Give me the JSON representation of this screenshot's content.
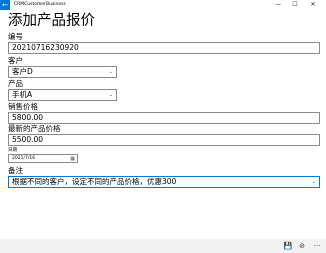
{
  "window": {
    "app_title": "CRMCustomerBusiness",
    "back_glyph": "←",
    "minimize_glyph": "—",
    "maximize_glyph": "☐",
    "close_glyph": "✕"
  },
  "page": {
    "title": "添加产品报价"
  },
  "form": {
    "number_label": "编号",
    "number_value": "20210716230920",
    "customer_label": "客户",
    "customer_value": "客户D",
    "product_label": "产品",
    "product_value": "手机A",
    "price_label": "销售价格",
    "price_value": "5800.00",
    "latest_price_label": "最新的产品价格",
    "latest_price_value": "5500.00",
    "date_label": "日期",
    "date_value": "2021/7/16",
    "remark_label": "备注",
    "remark_value": "根据不同的客户，设定不同的产品价格，优惠300"
  },
  "commandbar": {
    "save_icon": "save-icon",
    "cancel_icon": "cancel-icon",
    "more_glyph": "···"
  },
  "colors": {
    "accent": "#0078d7",
    "border": "#8a8a8a",
    "commandbar_bg": "#f2f2f2"
  }
}
